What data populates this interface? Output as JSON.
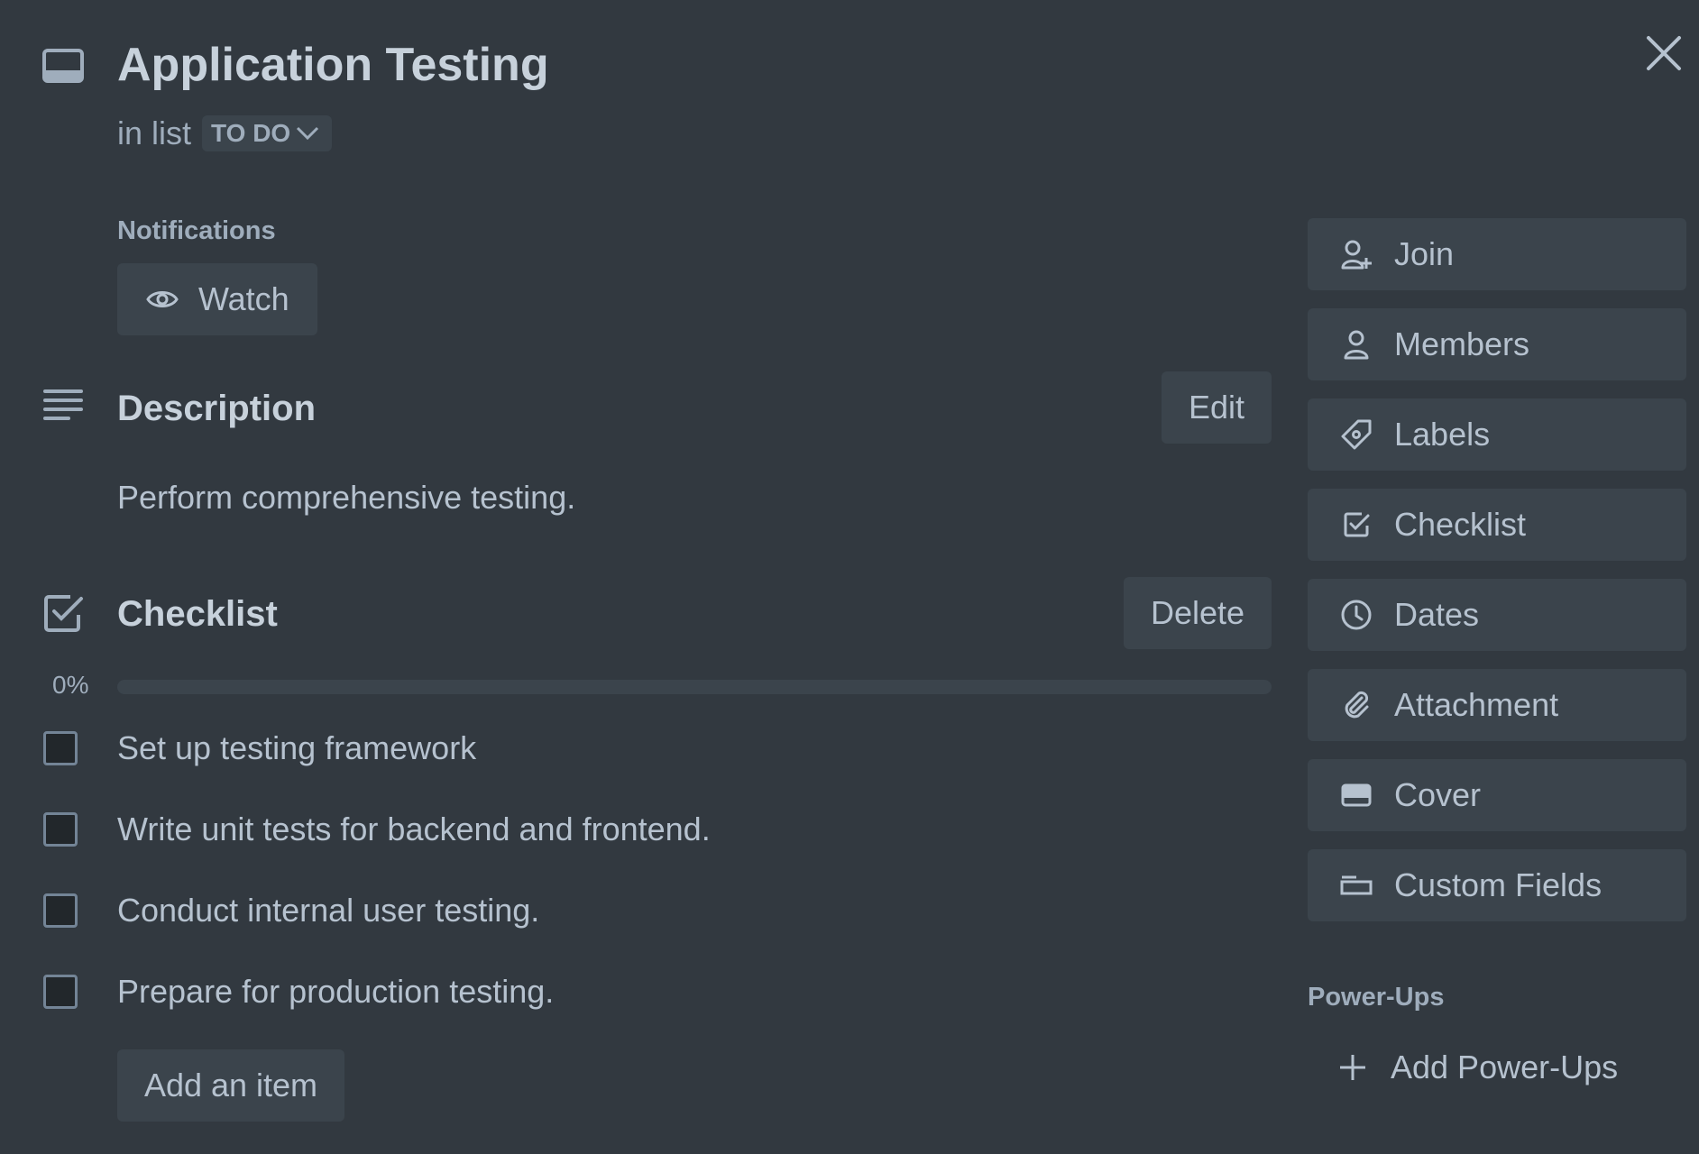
{
  "header": {
    "title": "Application Testing",
    "in_list_prefix": "in list",
    "list_name": "TO DO"
  },
  "notifications": {
    "label": "Notifications",
    "watch_label": "Watch"
  },
  "description": {
    "title": "Description",
    "edit_label": "Edit",
    "text": "Perform comprehensive testing."
  },
  "checklist": {
    "title": "Checklist",
    "delete_label": "Delete",
    "progress_text": "0%",
    "progress": 0,
    "items": [
      {
        "label": "Set up testing framework",
        "checked": false
      },
      {
        "label": "Write unit tests for backend and frontend.",
        "checked": false
      },
      {
        "label": "Conduct internal user testing.",
        "checked": false
      },
      {
        "label": "Prepare for production testing.",
        "checked": false
      }
    ],
    "add_item_label": "Add an item"
  },
  "sidebar": {
    "buttons": [
      {
        "label": "Join",
        "icon": "add-member-icon"
      },
      {
        "label": "Members",
        "icon": "person-icon"
      },
      {
        "label": "Labels",
        "icon": "tag-icon"
      },
      {
        "label": "Checklist",
        "icon": "checkbox-icon"
      },
      {
        "label": "Dates",
        "icon": "clock-icon"
      },
      {
        "label": "Attachment",
        "icon": "paperclip-icon"
      },
      {
        "label": "Cover",
        "icon": "cover-icon"
      },
      {
        "label": "Custom Fields",
        "icon": "custom-field-icon"
      }
    ],
    "power_ups_label": "Power-Ups",
    "add_power_ups_label": "Add Power-Ups"
  },
  "colors": {
    "background": "#323940",
    "button": "#3b444c",
    "text": "#b6c2cf",
    "heading": "#c7d1db",
    "muted": "#9fadbc"
  }
}
